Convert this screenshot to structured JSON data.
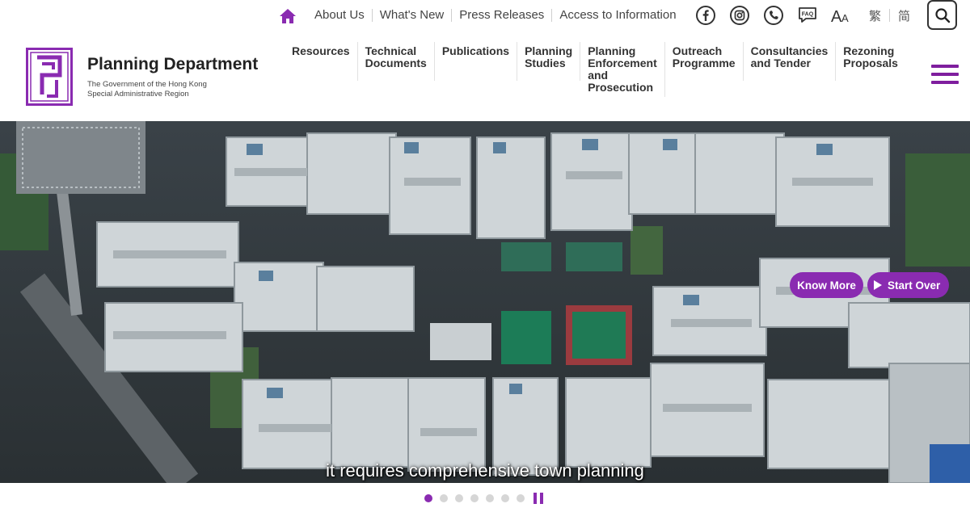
{
  "colors": {
    "accent": "#8a2bb1",
    "hamburger": "#7f1e9e",
    "text": "#333333"
  },
  "topbar": {
    "links": [
      "About Us",
      "What's New",
      "Press Releases",
      "Access to Information"
    ],
    "icons": [
      "home-icon",
      "facebook-icon",
      "instagram-icon",
      "phone-icon",
      "faq-icon",
      "font-size-icon",
      "search-icon"
    ],
    "languages": [
      "繁",
      "简"
    ]
  },
  "header": {
    "title": "Planning Department",
    "subtitle_line1": "The Government of the Hong Kong",
    "subtitle_line2": "Special Administrative Region"
  },
  "nav": {
    "items": [
      {
        "line1": "Resources",
        "line2": "",
        "line3": "",
        "line4": ""
      },
      {
        "line1": "Technical",
        "line2": "Documents",
        "line3": "",
        "line4": ""
      },
      {
        "line1": "Publications",
        "line2": "",
        "line3": "",
        "line4": ""
      },
      {
        "line1": "Planning",
        "line2": "Studies",
        "line3": "",
        "line4": ""
      },
      {
        "line1": "Planning",
        "line2": "Enforcement",
        "line3": "and",
        "line4": "Prosecution"
      },
      {
        "line1": "Outreach",
        "line2": "Programme",
        "line3": "",
        "line4": ""
      },
      {
        "line1": "Consultancies",
        "line2": "and Tender",
        "line3": "",
        "line4": ""
      },
      {
        "line1": "Rezoning",
        "line2": "Proposals",
        "line3": "",
        "line4": ""
      }
    ]
  },
  "hero": {
    "know_more": "Know More",
    "start_over": "Start Over",
    "caption": "it requires comprehensive town planning"
  },
  "carousel": {
    "slide_count": 7,
    "active_index": 0
  }
}
